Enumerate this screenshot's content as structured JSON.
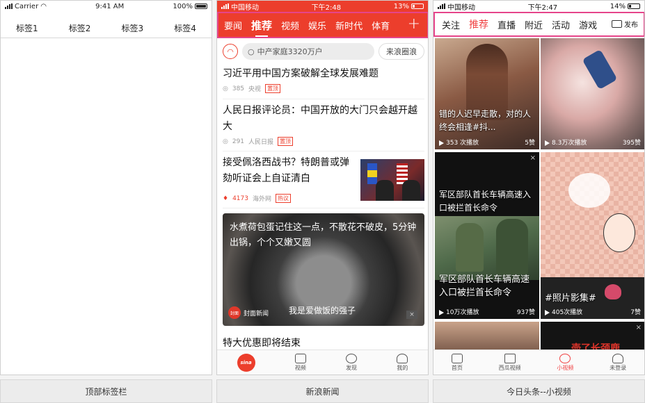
{
  "panel1": {
    "status": {
      "carrier": "Carrier",
      "time": "9:41 AM",
      "battery": "100%"
    },
    "tabs": [
      "标签1",
      "标签2",
      "标签3",
      "标签4"
    ],
    "caption": "顶部标签栏"
  },
  "panel2": {
    "status": {
      "carrier": "中国移动",
      "time": "下午2:48",
      "battery": "13%"
    },
    "nav": [
      "要闻",
      "推荐",
      "视频",
      "娱乐",
      "新时代",
      "体育"
    ],
    "nav_active": "推荐",
    "plus": "+",
    "search": {
      "placeholder": "中产家庭3320万户",
      "button": "来浪圈浪"
    },
    "news": [
      {
        "title": "习近平用中国方案破解全球发展难题",
        "count": "385",
        "source": "央视",
        "tag": "置顶"
      },
      {
        "title": "人民日报评论员：中国开放的大门只会越开越大",
        "count": "291",
        "source": "人民日报",
        "tag": "置顶"
      },
      {
        "title": "接受佩洛西战书？特朗普或弹劾听证会上自证清白",
        "count": "4173",
        "source": "海外网",
        "tag": "热议"
      }
    ],
    "video_card": {
      "title": "水煮荷包蛋记住这一点，不散花不破皮，5分钟出锅，个个又嫩又圆",
      "source": "封面新闻",
      "logo": "封面",
      "subtitle": "我是爱做饭的强子"
    },
    "next_title": "特大优惠即将结束",
    "tabbar": [
      "sina",
      "视频",
      "发现",
      "我的"
    ],
    "caption": "新浪新闻"
  },
  "panel3": {
    "status": {
      "carrier": "中国移动",
      "time": "下午2:47",
      "battery": "14%"
    },
    "nav": [
      "关注",
      "推荐",
      "直播",
      "附近",
      "活动",
      "游戏"
    ],
    "nav_active": "推荐",
    "publish": "发布",
    "tiles": [
      {
        "title": "错的人迟早走散，对的人终会相逢#抖...",
        "plays": "353 次播放",
        "likes": "5赞"
      },
      {
        "title": "",
        "plays": "8.3万次播放",
        "likes": "395赞"
      },
      {
        "title": "军区部队首长车辆高速入口被拦首长命令",
        "top_title": "军区部队首长车辆高速入口被拦首长命令",
        "plays": "10万次播放",
        "likes": "937赞"
      },
      {
        "title": "#照片影集#",
        "plays": "405次播放",
        "likes": "7赞"
      }
    ],
    "bottom_tile_text": "壶了长颈鹿",
    "tabbar": [
      "首页",
      "西瓜视频",
      "小视频",
      "未登录"
    ],
    "tab_active": "小视频",
    "caption": "今日头条--小视频"
  }
}
